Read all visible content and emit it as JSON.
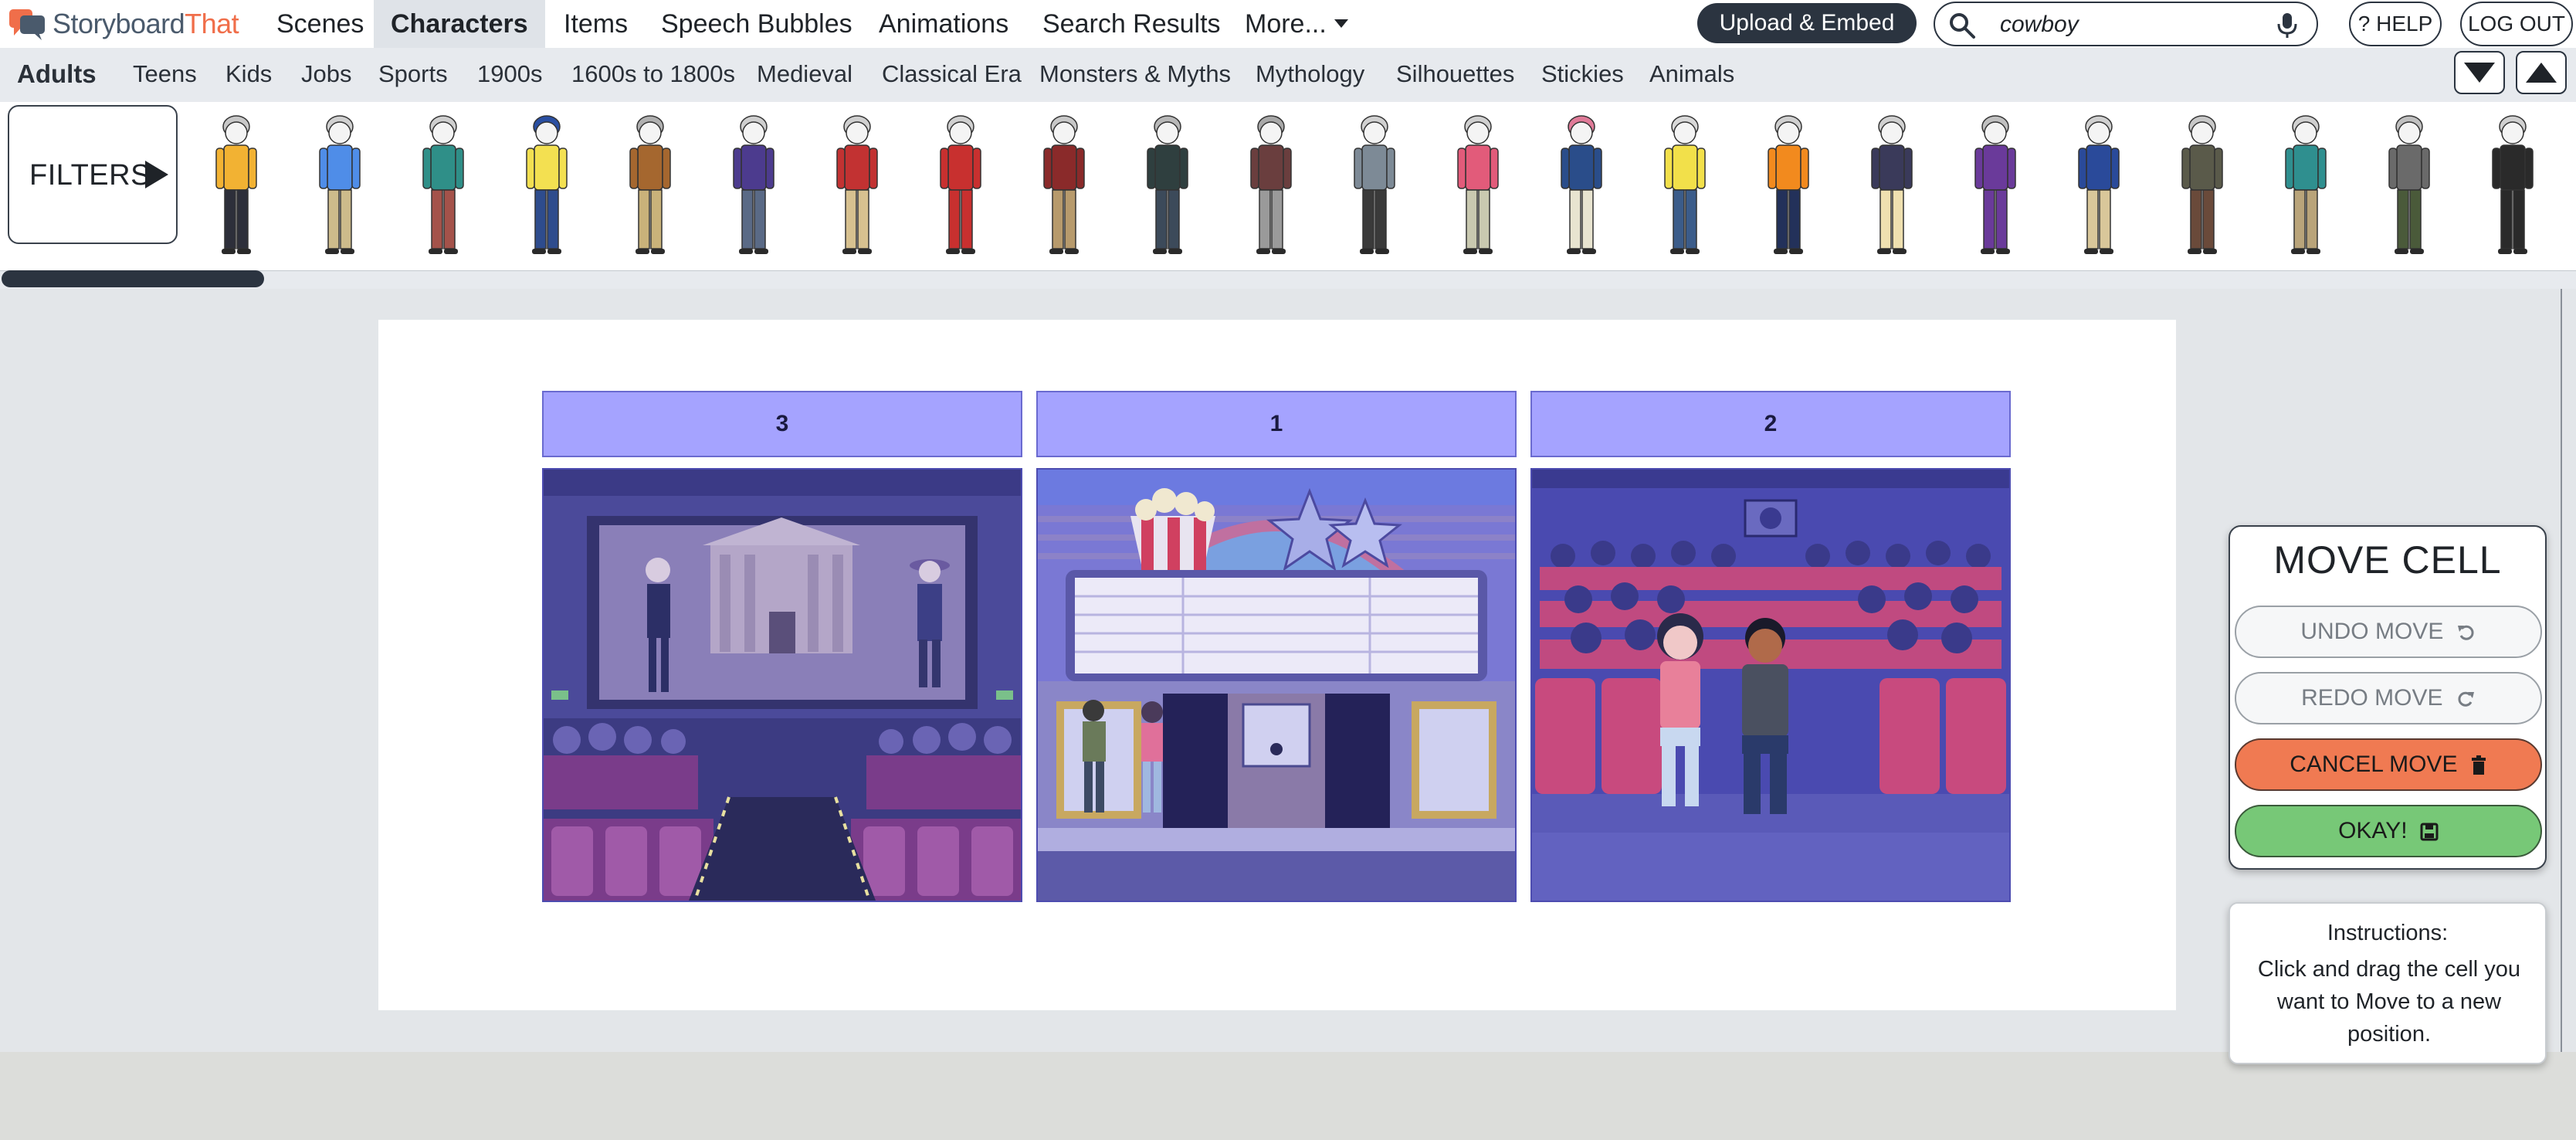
{
  "app": {
    "logo_part1": "Storyboard",
    "logo_part2": "That"
  },
  "nav": {
    "tabs": [
      {
        "label": "Scenes"
      },
      {
        "label": "Characters"
      },
      {
        "label": "Items"
      },
      {
        "label": "Speech Bubbles"
      },
      {
        "label": "Animations"
      },
      {
        "label": "Search Results"
      },
      {
        "label": "More..."
      }
    ],
    "active_tab": "Characters",
    "upload_label": "Upload & Embed",
    "search_value": "cowboy",
    "help_label": "? HELP",
    "logout_label": "LOG OUT"
  },
  "categories": {
    "items": [
      {
        "label": "Adults"
      },
      {
        "label": "Teens"
      },
      {
        "label": "Kids"
      },
      {
        "label": "Jobs"
      },
      {
        "label": "Sports"
      },
      {
        "label": "1900s"
      },
      {
        "label": "1600s to 1800s"
      },
      {
        "label": "Medieval"
      },
      {
        "label": "Classical Era"
      },
      {
        "label": "Monsters & Myths"
      },
      {
        "label": "Mythology"
      },
      {
        "label": "Silhouettes"
      },
      {
        "label": "Stickies"
      },
      {
        "label": "Animals"
      }
    ],
    "active": "Adults"
  },
  "library": {
    "filters_label": "FILTERS",
    "characters": [
      {
        "shirt": "#f2b233",
        "pants": "#2d2f3a",
        "hair": "#c8c8c8"
      },
      {
        "shirt": "#4f8de8",
        "pants": "#cdbb8b",
        "hair": "#d0d0d0"
      },
      {
        "shirt": "#2f8f88",
        "pants": "#a4524a",
        "hair": "#cfcfcf"
      },
      {
        "shirt": "#f3e051",
        "pants": "#2e4c8d",
        "hair": "#2a4fa2"
      },
      {
        "shirt": "#a5672f",
        "pants": "#c9b27a",
        "hair": "#b0b0b0"
      },
      {
        "shirt": "#4c3b8e",
        "pants": "#5a6a86",
        "hair": "#cfcfcf"
      },
      {
        "shirt": "#c23232",
        "pants": "#d7c190",
        "hair": "#d0d0d0"
      },
      {
        "shirt": "#c8302f",
        "pants": "#c8302f",
        "hair": "#d0d0d0"
      },
      {
        "shirt": "#8a2a2a",
        "pants": "#b79a6c",
        "hair": "#c8c8c8"
      },
      {
        "shirt": "#2f3f3f",
        "pants": "#3c4a5a",
        "hair": "#b8b8b8"
      },
      {
        "shirt": "#6a3e3e",
        "pants": "#9a9a9a",
        "hair": "#a8a8a8"
      },
      {
        "shirt": "#7d8a96",
        "pants": "#3a3a3a",
        "hair": "#d0d0d0"
      },
      {
        "shirt": "#e25b7a",
        "pants": "#c9c9b0",
        "hair": "#d0d0d0"
      },
      {
        "shirt": "#2a4d8a",
        "pants": "#e8e4d0",
        "hair": "#e07a98"
      },
      {
        "shirt": "#f2e04a",
        "pants": "#3b5c8a",
        "hair": "#d8d8d8"
      },
      {
        "shirt": "#f28a1e",
        "pants": "#23315a",
        "hair": "#d0d0d0"
      },
      {
        "shirt": "#3a3a5a",
        "pants": "#efe0b0",
        "hair": "#d0d0d0"
      },
      {
        "shirt": "#6a3a9a",
        "pants": "#6a3a9a",
        "hair": "#c0c0c0"
      },
      {
        "shirt": "#2a4a9a",
        "pants": "#d9c79a",
        "hair": "#d0d0d0"
      },
      {
        "shirt": "#5a5a4a",
        "pants": "#6a4a3a",
        "hair": "#c8c8c8"
      },
      {
        "shirt": "#2f8f8f",
        "pants": "#b9a47a",
        "hair": "#d0d0d0"
      },
      {
        "shirt": "#6a6a6a",
        "pants": "#4a5a3a",
        "hair": "#c0c0c0"
      },
      {
        "shirt": "#2a2a2a",
        "pants": "#2a2a2a",
        "hair": "#d0d0d0"
      }
    ]
  },
  "storyboard": {
    "cells": [
      {
        "title": "3",
        "scene": "movie-screen-auditorium"
      },
      {
        "title": "1",
        "scene": "theater-marquee-exterior"
      },
      {
        "title": "2",
        "scene": "audience-seats-couple"
      }
    ]
  },
  "move_panel": {
    "title": "MOVE CELL",
    "undo_label": "UNDO MOVE",
    "redo_label": "REDO MOVE",
    "cancel_label": "CANCEL MOVE",
    "okay_label": "OKAY!"
  },
  "instructions": {
    "title": "Instructions:",
    "text": "Click and drag the cell you want to Move to a new position."
  },
  "colors": {
    "accent_dark": "#2b3440",
    "brand_orange": "#f06e4a",
    "cell_title_bg": "#a5a3ff",
    "cancel_bg": "#f07a52",
    "okay_bg": "#77c877"
  }
}
